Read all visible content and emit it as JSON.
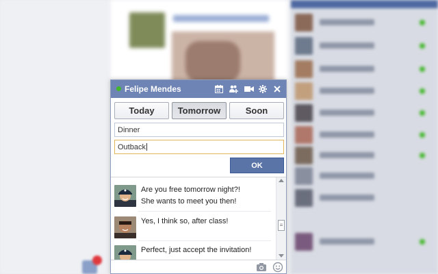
{
  "chat": {
    "title": "Felipe Mendes",
    "status_color": "#42b72a",
    "header_icons": [
      "calendar-icon",
      "add-friend-icon",
      "video-call-icon",
      "settings-icon",
      "close-icon"
    ]
  },
  "event_form": {
    "date_options": [
      "Today",
      "Tomorrow",
      "Soon"
    ],
    "selected_date": "Tomorrow",
    "title_value": "Dinner",
    "location_value": "Outback",
    "ok_label": "OK"
  },
  "messages": [
    {
      "line1": "Are you free tomorrow night?!",
      "line2": "She wants to meet you then!",
      "sender": "other"
    },
    {
      "line1": "Yes, I think so, after class!",
      "line2": "",
      "sender": "felipe"
    },
    {
      "line1": "Perfect, just accept the invitation!",
      "line2": "",
      "sender": "other"
    }
  ],
  "composer": {
    "icons": [
      "camera-icon",
      "emoji-icon"
    ]
  },
  "colors": {
    "header_bg": "#6d84b4",
    "ok_button": "#5b74a8",
    "focus_border": "#e1b65a"
  }
}
